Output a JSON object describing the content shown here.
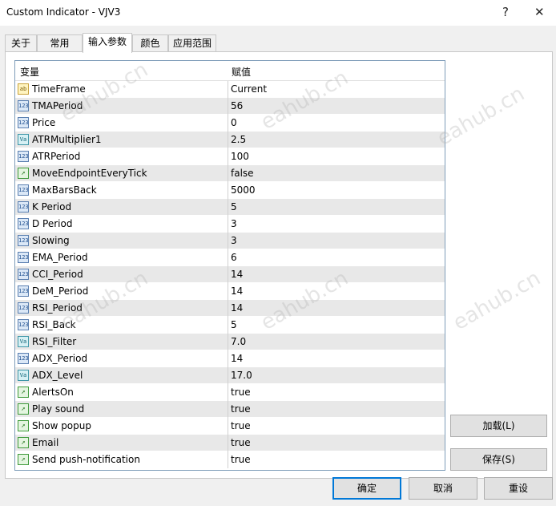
{
  "window": {
    "title": "Custom Indicator - VJV3",
    "help_glyph": "?",
    "close_glyph": "✕"
  },
  "tabs": [
    {
      "label": "关于"
    },
    {
      "label": "常用"
    },
    {
      "label": "输入参数"
    },
    {
      "label": "颜色"
    },
    {
      "label": "应用范围"
    }
  ],
  "table": {
    "headers": {
      "variable": "变量",
      "value": "赋值"
    },
    "rows": [
      {
        "icon": "ab",
        "name": "TimeFrame",
        "value": "Current"
      },
      {
        "icon": "123",
        "name": "TMAPeriod",
        "value": "56"
      },
      {
        "icon": "123",
        "name": "Price",
        "value": "0"
      },
      {
        "icon": "Va",
        "name": "ATRMultiplier1",
        "value": "2.5"
      },
      {
        "icon": "123",
        "name": "ATRPeriod",
        "value": "100"
      },
      {
        "icon": "bool",
        "name": "MoveEndpointEveryTick",
        "value": "false"
      },
      {
        "icon": "123",
        "name": "MaxBarsBack",
        "value": "5000"
      },
      {
        "icon": "123",
        "name": "K Period",
        "value": "5"
      },
      {
        "icon": "123",
        "name": "D Period",
        "value": "3"
      },
      {
        "icon": "123",
        "name": "Slowing",
        "value": "3"
      },
      {
        "icon": "123",
        "name": "EMA_Period",
        "value": "6"
      },
      {
        "icon": "123",
        "name": "CCI_Period",
        "value": "14"
      },
      {
        "icon": "123",
        "name": "DeM_Period",
        "value": "14"
      },
      {
        "icon": "123",
        "name": "RSI_Period",
        "value": "14"
      },
      {
        "icon": "123",
        "name": "RSI_Back",
        "value": "5"
      },
      {
        "icon": "Va",
        "name": "RSI_Filter",
        "value": "7.0"
      },
      {
        "icon": "123",
        "name": "ADX_Period",
        "value": "14"
      },
      {
        "icon": "Va",
        "name": "ADX_Level",
        "value": "17.0"
      },
      {
        "icon": "bool",
        "name": "AlertsOn",
        "value": "true"
      },
      {
        "icon": "bool",
        "name": "Play sound",
        "value": "true"
      },
      {
        "icon": "bool",
        "name": "Show popup",
        "value": "true"
      },
      {
        "icon": "bool",
        "name": "Email",
        "value": "true"
      },
      {
        "icon": "bool",
        "name": "Send push-notification",
        "value": "true"
      }
    ]
  },
  "buttons": {
    "load": "加载(L)",
    "save": "保存(S)",
    "ok": "确定",
    "cancel": "取消",
    "reset": "重设"
  },
  "watermark": "eahub.cn",
  "colors": {
    "accent": "#0078d7",
    "row_alt": "#e8e8e8"
  }
}
